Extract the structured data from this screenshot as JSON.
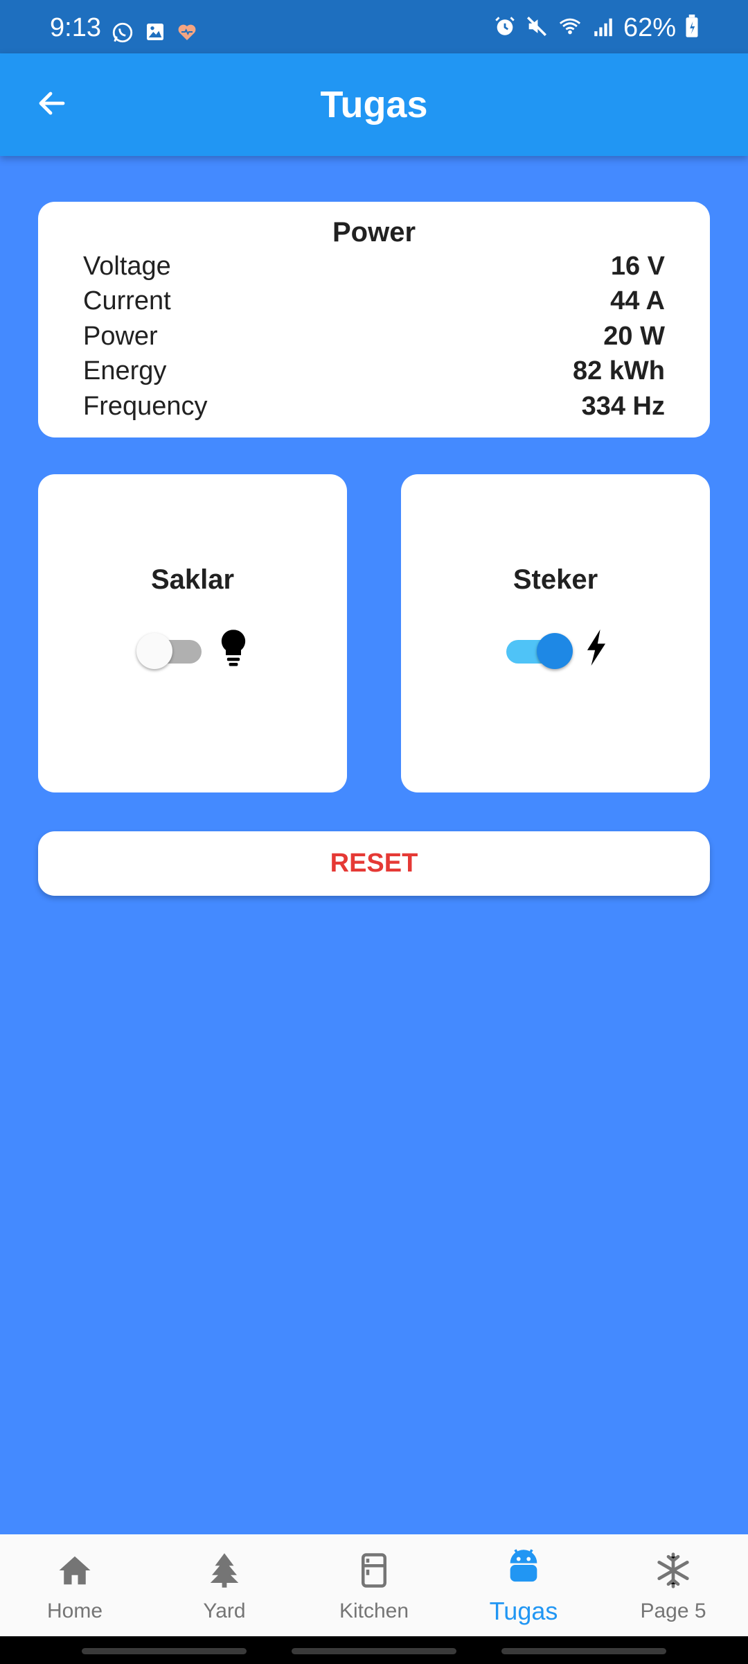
{
  "status_bar": {
    "time": "9:13",
    "battery": "62%",
    "left_icons": [
      "whatsapp-icon",
      "image-icon",
      "heart-icon"
    ],
    "right_icons": [
      "alarm-icon",
      "mute-icon",
      "wifi-icon",
      "signal-icon",
      "battery-icon"
    ]
  },
  "app_bar": {
    "title": "Tugas",
    "back_icon": "arrow-left-icon"
  },
  "power_card": {
    "title": "Power",
    "rows": [
      {
        "label": "Voltage",
        "value": "16 V"
      },
      {
        "label": "Current",
        "value": "44 A"
      },
      {
        "label": "Power",
        "value": "20 W"
      },
      {
        "label": "Energy",
        "value": "82 kWh"
      },
      {
        "label": "Frequency",
        "value": "334 Hz"
      }
    ]
  },
  "switches": [
    {
      "title": "Saklar",
      "state": "off",
      "icon": "lightbulb-icon"
    },
    {
      "title": "Steker",
      "state": "on",
      "icon": "bolt-icon"
    }
  ],
  "reset_button": {
    "label": "RESET"
  },
  "bottom_nav": {
    "active_index": 3,
    "items": [
      {
        "label": "Home",
        "icon": "home-icon"
      },
      {
        "label": "Yard",
        "icon": "tree-icon"
      },
      {
        "label": "Kitchen",
        "icon": "fridge-icon"
      },
      {
        "label": "Tugas",
        "icon": "android-icon"
      },
      {
        "label": "Page 5",
        "icon": "snowflake-icon"
      }
    ]
  },
  "colors": {
    "background": "#448AFF",
    "app_bar": "#2196F3",
    "status_bar": "#1E6FBF",
    "reset_text": "#E53935",
    "active_nav": "#2196F3",
    "inactive_nav": "#757575"
  }
}
